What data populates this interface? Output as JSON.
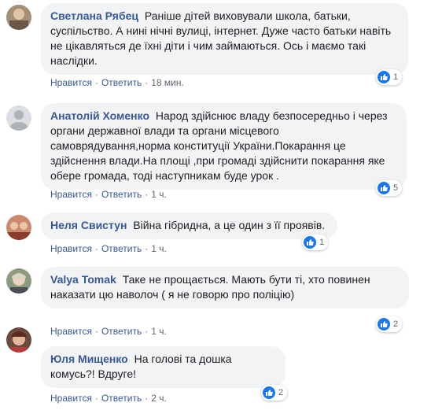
{
  "actions": {
    "like_label": "Нравится",
    "reply_label": "Ответить",
    "separator": "·"
  },
  "comments": [
    {
      "author": "Светлана Рябец",
      "text": "Раніше дітей виховували школа, батьки, суспільство. А нині нічні вулиці, інтернет. Дуже часто батьки навіть не цікавляться де їхні діти і чим займаються. Ось і маємо такі наслідки.",
      "time": "18 мин.",
      "reactions": "1"
    },
    {
      "author": "Анатолій Хоменко",
      "text": "Народ здійснює владу безпосередньо і через органи державної влади та органи місцевого самоврядування,норма конституції України.Покарання це здійснення влади.На площі ,при громаді здійснити покарання яке обере громада, тоді наступникам буде урок .",
      "time": "1 ч.",
      "reactions": "5"
    },
    {
      "author": "Неля Свистун",
      "text": "Війна гібридна, а це один з її проявів.",
      "time": "1 ч.",
      "reactions": "1"
    },
    {
      "author": "Valya Tomak",
      "text": "Таке не прощається. Мають бути ті, хто повинен наказати цю наволоч ( я не говорю про поліцію)",
      "time": "1 ч.",
      "reactions": "2"
    },
    {
      "author": "Юля Мищенко",
      "text": "На голові та дошка комусь?! Вдруге!",
      "time": "2 ч.",
      "reactions": "2"
    }
  ]
}
